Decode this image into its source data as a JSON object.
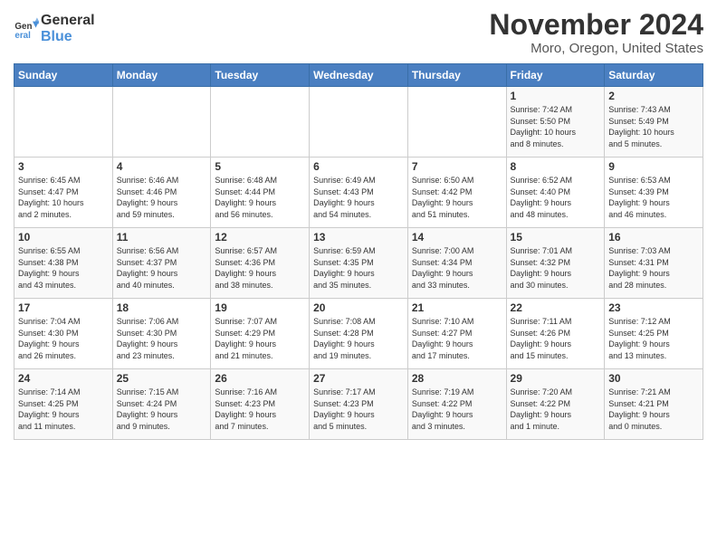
{
  "logo": {
    "line1": "General",
    "line2": "Blue"
  },
  "title": "November 2024",
  "location": "Moro, Oregon, United States",
  "weekdays": [
    "Sunday",
    "Monday",
    "Tuesday",
    "Wednesday",
    "Thursday",
    "Friday",
    "Saturday"
  ],
  "weeks": [
    [
      {
        "day": "",
        "info": ""
      },
      {
        "day": "",
        "info": ""
      },
      {
        "day": "",
        "info": ""
      },
      {
        "day": "",
        "info": ""
      },
      {
        "day": "",
        "info": ""
      },
      {
        "day": "1",
        "info": "Sunrise: 7:42 AM\nSunset: 5:50 PM\nDaylight: 10 hours\nand 8 minutes."
      },
      {
        "day": "2",
        "info": "Sunrise: 7:43 AM\nSunset: 5:49 PM\nDaylight: 10 hours\nand 5 minutes."
      }
    ],
    [
      {
        "day": "3",
        "info": "Sunrise: 6:45 AM\nSunset: 4:47 PM\nDaylight: 10 hours\nand 2 minutes."
      },
      {
        "day": "4",
        "info": "Sunrise: 6:46 AM\nSunset: 4:46 PM\nDaylight: 9 hours\nand 59 minutes."
      },
      {
        "day": "5",
        "info": "Sunrise: 6:48 AM\nSunset: 4:44 PM\nDaylight: 9 hours\nand 56 minutes."
      },
      {
        "day": "6",
        "info": "Sunrise: 6:49 AM\nSunset: 4:43 PM\nDaylight: 9 hours\nand 54 minutes."
      },
      {
        "day": "7",
        "info": "Sunrise: 6:50 AM\nSunset: 4:42 PM\nDaylight: 9 hours\nand 51 minutes."
      },
      {
        "day": "8",
        "info": "Sunrise: 6:52 AM\nSunset: 4:40 PM\nDaylight: 9 hours\nand 48 minutes."
      },
      {
        "day": "9",
        "info": "Sunrise: 6:53 AM\nSunset: 4:39 PM\nDaylight: 9 hours\nand 46 minutes."
      }
    ],
    [
      {
        "day": "10",
        "info": "Sunrise: 6:55 AM\nSunset: 4:38 PM\nDaylight: 9 hours\nand 43 minutes."
      },
      {
        "day": "11",
        "info": "Sunrise: 6:56 AM\nSunset: 4:37 PM\nDaylight: 9 hours\nand 40 minutes."
      },
      {
        "day": "12",
        "info": "Sunrise: 6:57 AM\nSunset: 4:36 PM\nDaylight: 9 hours\nand 38 minutes."
      },
      {
        "day": "13",
        "info": "Sunrise: 6:59 AM\nSunset: 4:35 PM\nDaylight: 9 hours\nand 35 minutes."
      },
      {
        "day": "14",
        "info": "Sunrise: 7:00 AM\nSunset: 4:34 PM\nDaylight: 9 hours\nand 33 minutes."
      },
      {
        "day": "15",
        "info": "Sunrise: 7:01 AM\nSunset: 4:32 PM\nDaylight: 9 hours\nand 30 minutes."
      },
      {
        "day": "16",
        "info": "Sunrise: 7:03 AM\nSunset: 4:31 PM\nDaylight: 9 hours\nand 28 minutes."
      }
    ],
    [
      {
        "day": "17",
        "info": "Sunrise: 7:04 AM\nSunset: 4:30 PM\nDaylight: 9 hours\nand 26 minutes."
      },
      {
        "day": "18",
        "info": "Sunrise: 7:06 AM\nSunset: 4:30 PM\nDaylight: 9 hours\nand 23 minutes."
      },
      {
        "day": "19",
        "info": "Sunrise: 7:07 AM\nSunset: 4:29 PM\nDaylight: 9 hours\nand 21 minutes."
      },
      {
        "day": "20",
        "info": "Sunrise: 7:08 AM\nSunset: 4:28 PM\nDaylight: 9 hours\nand 19 minutes."
      },
      {
        "day": "21",
        "info": "Sunrise: 7:10 AM\nSunset: 4:27 PM\nDaylight: 9 hours\nand 17 minutes."
      },
      {
        "day": "22",
        "info": "Sunrise: 7:11 AM\nSunset: 4:26 PM\nDaylight: 9 hours\nand 15 minutes."
      },
      {
        "day": "23",
        "info": "Sunrise: 7:12 AM\nSunset: 4:25 PM\nDaylight: 9 hours\nand 13 minutes."
      }
    ],
    [
      {
        "day": "24",
        "info": "Sunrise: 7:14 AM\nSunset: 4:25 PM\nDaylight: 9 hours\nand 11 minutes."
      },
      {
        "day": "25",
        "info": "Sunrise: 7:15 AM\nSunset: 4:24 PM\nDaylight: 9 hours\nand 9 minutes."
      },
      {
        "day": "26",
        "info": "Sunrise: 7:16 AM\nSunset: 4:23 PM\nDaylight: 9 hours\nand 7 minutes."
      },
      {
        "day": "27",
        "info": "Sunrise: 7:17 AM\nSunset: 4:23 PM\nDaylight: 9 hours\nand 5 minutes."
      },
      {
        "day": "28",
        "info": "Sunrise: 7:19 AM\nSunset: 4:22 PM\nDaylight: 9 hours\nand 3 minutes."
      },
      {
        "day": "29",
        "info": "Sunrise: 7:20 AM\nSunset: 4:22 PM\nDaylight: 9 hours\nand 1 minute."
      },
      {
        "day": "30",
        "info": "Sunrise: 7:21 AM\nSunset: 4:21 PM\nDaylight: 9 hours\nand 0 minutes."
      }
    ]
  ]
}
